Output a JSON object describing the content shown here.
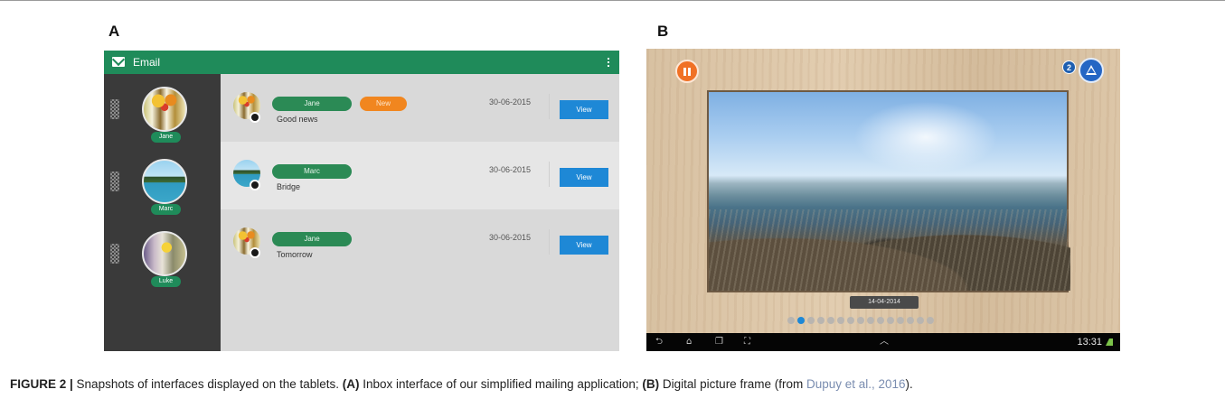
{
  "figure": {
    "panel_a_letter": "A",
    "panel_b_letter": "B",
    "caption": {
      "label": "FIGURE 2 |",
      "intro": " Snapshots of interfaces displayed on the tablets. ",
      "a_marker": "(A)",
      "a_text": " Inbox interface of our simplified mailing application; ",
      "b_marker": "(B)",
      "b_text": " Digital picture frame (from ",
      "citation": "Dupuy et al., 2016",
      "end": ")."
    }
  },
  "email_app": {
    "title": "Email",
    "header_icon": "mail-icon",
    "menu_icon": "overflow-menu-icon",
    "colors": {
      "header": "#1f8b5a",
      "sidebar": "#3a3a3a",
      "view_button": "#1e88d6",
      "new_tag": "#f1861f"
    },
    "contacts": [
      {
        "name": "Jane",
        "avatar": "flowers-photo"
      },
      {
        "name": "Marc",
        "avatar": "island-photo"
      },
      {
        "name": "Luke",
        "avatar": "flowers-photo"
      }
    ],
    "messages": [
      {
        "sender": "Jane",
        "tag": "New",
        "subject": "Good news",
        "date": "30-06-2015",
        "action": "View"
      },
      {
        "sender": "Marc",
        "tag": "",
        "subject": "Bridge",
        "date": "30-06-2015",
        "action": "View"
      },
      {
        "sender": "Jane",
        "tag": "",
        "subject": "Tomorrow",
        "date": "30-06-2015",
        "action": "View"
      }
    ]
  },
  "picture_frame": {
    "pause_icon": "pause-icon",
    "alert_count": "2",
    "alert_icon": "warning-icon",
    "photo_date": "14-04-2014",
    "slide_count": 15,
    "active_slide": 2,
    "status_time": "13:31",
    "nav_icons": [
      "back-icon",
      "home-icon",
      "recent-apps-icon",
      "screenshot-icon",
      "chevron-up-icon"
    ],
    "colors": {
      "pause": "#f07125",
      "alert": "#2566c4",
      "active_dot": "#1e88d6"
    }
  }
}
